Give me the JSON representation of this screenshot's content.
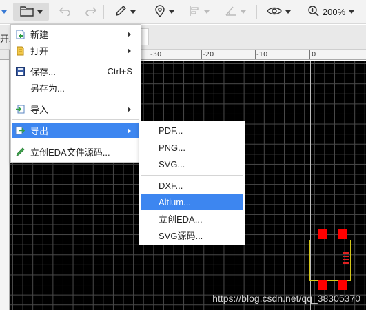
{
  "toolbar": {
    "zoom_label": "200%"
  },
  "tabstrip": {
    "tab_stub": "开发"
  },
  "ruler": {
    "top_labels": [
      "-30",
      "-20",
      "-10",
      "0"
    ]
  },
  "file_menu": {
    "items": [
      {
        "label": "新建",
        "icon": "new-file-icon",
        "shortcut": ""
      },
      {
        "label": "打开",
        "icon": "open-folder-icon",
        "shortcut": ""
      },
      {
        "label": "保存...",
        "icon": "save-disk-icon",
        "shortcut": "Ctrl+S"
      },
      {
        "label": "另存为...",
        "icon": "",
        "shortcut": ""
      },
      {
        "label": "导入",
        "icon": "import-icon",
        "shortcut": ""
      },
      {
        "label": "导出",
        "icon": "export-icon",
        "shortcut": ""
      },
      {
        "label": "立创EDA文件源码...",
        "icon": "pencil-icon",
        "shortcut": ""
      }
    ]
  },
  "export_submenu": {
    "items": [
      {
        "label": "PDF..."
      },
      {
        "label": "PNG..."
      },
      {
        "label": "SVG..."
      },
      {
        "label": "DXF..."
      },
      {
        "label": "Altium..."
      },
      {
        "label": "立创EDA..."
      },
      {
        "label": "SVG源码..."
      }
    ]
  },
  "watermark": "https://blog.csdn.net/qq_38305370",
  "colors": {
    "canvas_bg": "#000000",
    "grid": "#4a4a4a",
    "menu_highlight": "#3d86f0",
    "pad": "#ff0000",
    "outline": "#d4c619"
  }
}
